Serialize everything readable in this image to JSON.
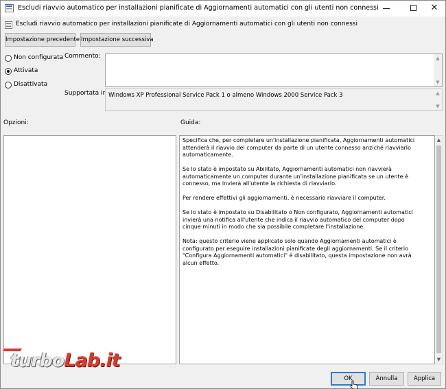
{
  "window": {
    "title": "Escludi riavvio automatico per installazioni pianificate di Aggiornamenti automatici con gli utenti non connessi",
    "minimize_icon": "minimize-icon",
    "maximize_icon": "maximize-icon",
    "close_glyph": "✕"
  },
  "policy": {
    "title": "Escludi riavvio automatico per installazioni pianificate di Aggiornamenti automatici con gli utenti non connessi"
  },
  "nav": {
    "prev_label": "Impostazione precedente",
    "next_label": "Impostazione successiva"
  },
  "state": {
    "options": [
      {
        "label": "Non configurata",
        "checked": false
      },
      {
        "label": "Attivata",
        "checked": true
      },
      {
        "label": "Disattivata",
        "checked": false
      }
    ]
  },
  "comment": {
    "label": "Commento:",
    "value": ""
  },
  "supported": {
    "label": "Supportata in:",
    "value": "Windows XP Professional Service Pack 1 o almeno Windows 2000 Service Pack 3"
  },
  "options_section": {
    "label": "Opzioni:"
  },
  "help_section": {
    "label": "Guida:",
    "paragraphs": [
      "Specifica che, per completare un'installazione pianificata, Aggiornamenti automatici attenderà il riavvio del computer da parte di un utente connesso anziché riavviarlo automaticamente.",
      "Se lo stato è impostato su Abilitato, Aggiornamenti automatici non riavvierà automaticamente un computer durante un'installazione pianificata se un utente è connesso, ma invierà all'utente la richiesta di riavviarlo.",
      "Per rendere effettivi gli aggiornamenti, è necessario riavviare il computer.",
      "Se lo stato è impostato su Disabilitato o Non configurato, Aggiornamenti automatici invierà una notifica all'utente che indica il riavvio automatico del computer dopo cinque minuti in modo che sia possibile completare l'installazione.",
      "Nota: questo criterio viene applicato solo quando Aggiornamenti automatici è configurato per eseguire installazioni pianificate degli aggiornamenti. Se il criterio \"Configura Aggiornamenti automatici\" è disabilitato, questa impostazione non avrà alcun effetto."
    ]
  },
  "footer": {
    "ok_label": "OK",
    "cancel_label": "Annulla",
    "apply_label": "Applica"
  },
  "watermark": {
    "part1": "turbo",
    "part2": "Lab.it"
  },
  "colors": {
    "accent": "#2f7ad2",
    "brand_red": "#d83a2e"
  }
}
